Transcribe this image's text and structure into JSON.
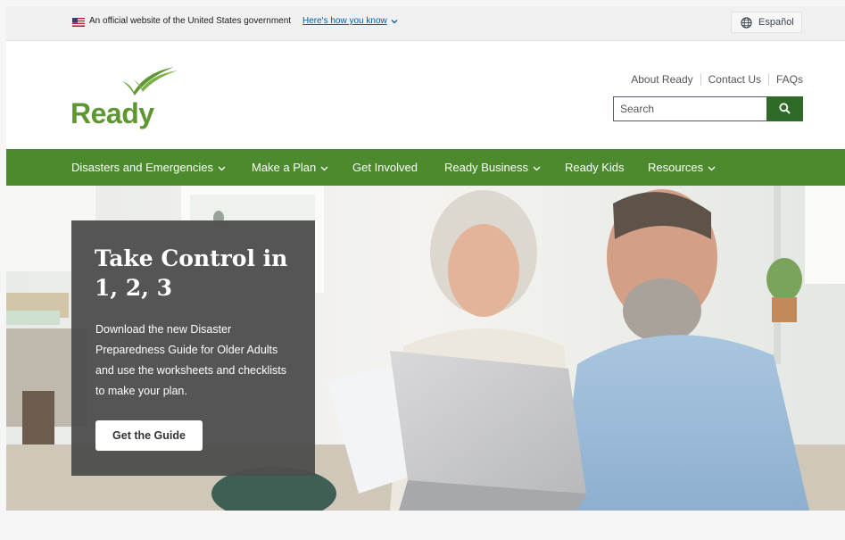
{
  "gov_banner": {
    "text": "An official website of the United States government",
    "link": "Here's how you know",
    "language_button": "Español"
  },
  "header": {
    "logo_text": "Ready",
    "utility_links": [
      "About Ready",
      "Contact Us",
      "FAQs"
    ],
    "search": {
      "placeholder": "Search"
    }
  },
  "nav": {
    "items": [
      {
        "label": "Disasters and Emergencies",
        "has_dropdown": true
      },
      {
        "label": "Make a Plan",
        "has_dropdown": true
      },
      {
        "label": "Get Involved",
        "has_dropdown": false
      },
      {
        "label": "Ready Business",
        "has_dropdown": true
      },
      {
        "label": "Ready Kids",
        "has_dropdown": false
      },
      {
        "label": "Resources",
        "has_dropdown": true
      }
    ]
  },
  "hero": {
    "title": "Take Control in 1, 2, 3",
    "description": "Download the new Disaster Preparedness Guide for Older Adults and use the worksheets and checklists to make your plan.",
    "button": "Get the Guide"
  },
  "icons": {
    "flag": "us-flag-icon",
    "chevron": "chevron-down-icon",
    "globe": "globe-icon",
    "search": "search-icon",
    "logo_mark": "checkmark-logo-icon"
  },
  "colors": {
    "brand_green": "#4b8a2d",
    "logo_green": "#5e9732",
    "search_button": "#2e6b26",
    "link_blue": "#005ea2",
    "card_gray": "#4e4e4e"
  }
}
